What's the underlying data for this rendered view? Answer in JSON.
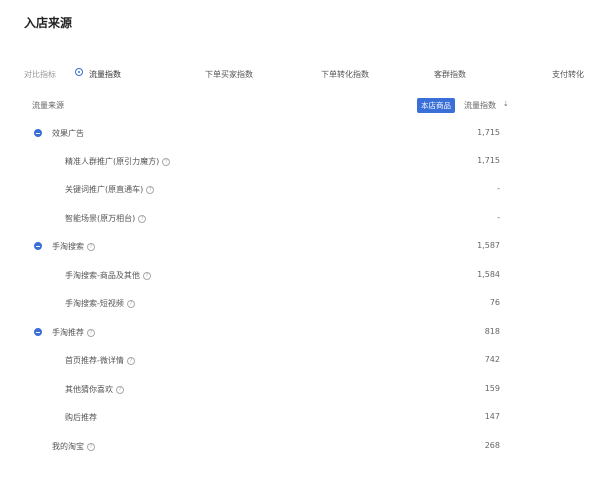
{
  "title": "入店来源",
  "metrics": {
    "label": "对比指标",
    "options": [
      "流量指数",
      "下单买家指数",
      "下单转化指数",
      "客群指数",
      "支付转化"
    ]
  },
  "table": {
    "source_header": "流量来源",
    "badge": "本店商品",
    "index_header": "流量指数",
    "sort_glyph": "⇣",
    "rows": [
      {
        "name": "效果广告",
        "value": "1,715"
      },
      {
        "name": "精准人群推广(原引力魔方)",
        "value": "1,715"
      },
      {
        "name": "关键词推广(原直通车)",
        "value": "-"
      },
      {
        "name": "智能场景(原万相台)",
        "value": "-"
      },
      {
        "name": "手淘搜索",
        "value": "1,587"
      },
      {
        "name": "手淘搜索-商品及其他",
        "value": "1,584"
      },
      {
        "name": "手淘搜索-短视频",
        "value": "76"
      },
      {
        "name": "手淘推荐",
        "value": "818"
      },
      {
        "name": "首页推荐-微详情",
        "value": "742"
      },
      {
        "name": "其他猜你喜欢",
        "value": "159"
      },
      {
        "name": "购后推荐",
        "value": "147"
      },
      {
        "name": "我的淘宝",
        "value": "268"
      }
    ]
  }
}
